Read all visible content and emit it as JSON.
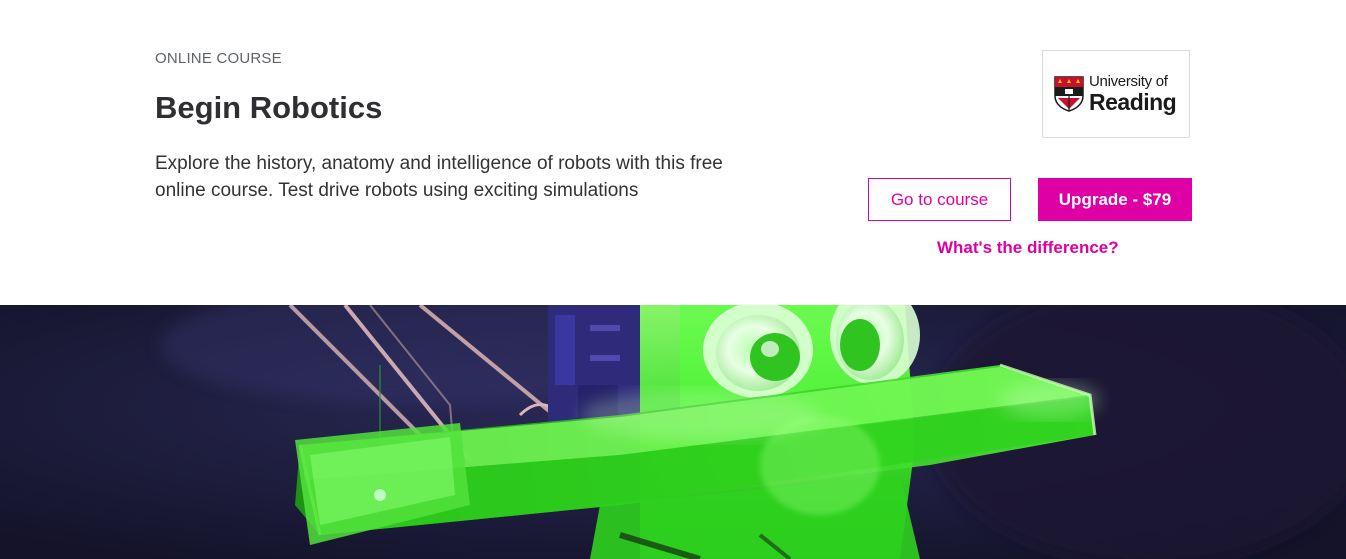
{
  "course": {
    "eyebrow": "ONLINE COURSE",
    "title": "Begin Robotics",
    "description": "Explore the history, anatomy and intelligence of robots with this free online course. Test drive robots using exciting simulations"
  },
  "logo": {
    "line1": "University of",
    "line2": "Reading",
    "icon": "university-crest-icon"
  },
  "actions": {
    "go_to_course": "Go to course",
    "upgrade": "Upgrade - $79",
    "difference_link": "What's the difference?"
  },
  "hero": {
    "image": "green-acrylic-robot-photo"
  },
  "colors": {
    "accent": "#de00a5",
    "text_dark": "#2f2f33",
    "eyebrow": "#5f6368",
    "hero_bg": "#1b1a33",
    "robot_green": "#4dff3a"
  }
}
